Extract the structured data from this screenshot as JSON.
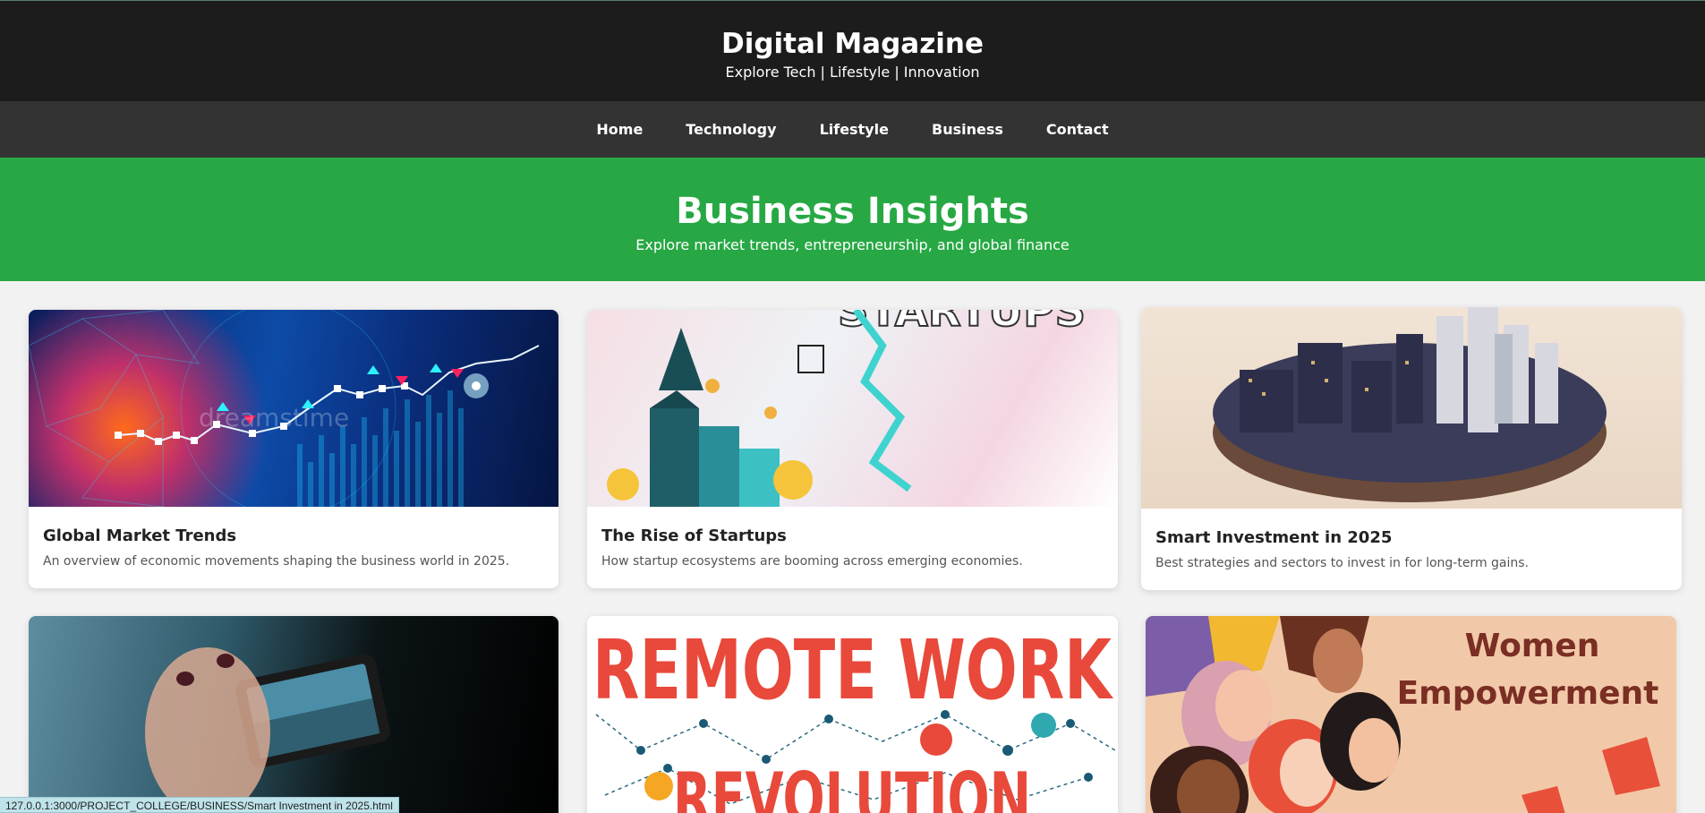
{
  "header": {
    "title": "Digital Magazine",
    "tagline": "Explore Tech | Lifestyle | Innovation"
  },
  "nav": {
    "items": [
      "Home",
      "Technology",
      "Lifestyle",
      "Business",
      "Contact"
    ]
  },
  "hero": {
    "title": "Business Insights",
    "subtitle": "Explore market trends, entrepreneurship, and global finance"
  },
  "cards": [
    {
      "title": "Global Market Trends",
      "desc": "An overview of economic movements shaping the business world in 2025."
    },
    {
      "title": "The Rise of Startups",
      "desc": "How startup ecosystems are booming across emerging economies."
    },
    {
      "title": "Smart Investment in 2025",
      "desc": "Best strategies and sectors to invest in for long-term gains."
    }
  ],
  "images": {
    "startups_text": "STARTUPS",
    "watermark": "dreamstime",
    "remote_line1": "REMOTE WORK",
    "remote_line2": "REVOLUTION",
    "women_line1": "Women",
    "women_line2": "Empowerment"
  },
  "status_bar": {
    "url": "127.0.0.1:3000/PROJECT_COLLEGE/BUSINESS/Smart Investment in 2025.html"
  },
  "colors": {
    "header_bg": "#1c1c1c",
    "nav_bg": "#333333",
    "hero_bg": "#27a844",
    "page_bg": "#f2f2f2",
    "remote_red": "#e8493a",
    "women_title": "#7a2e24"
  }
}
